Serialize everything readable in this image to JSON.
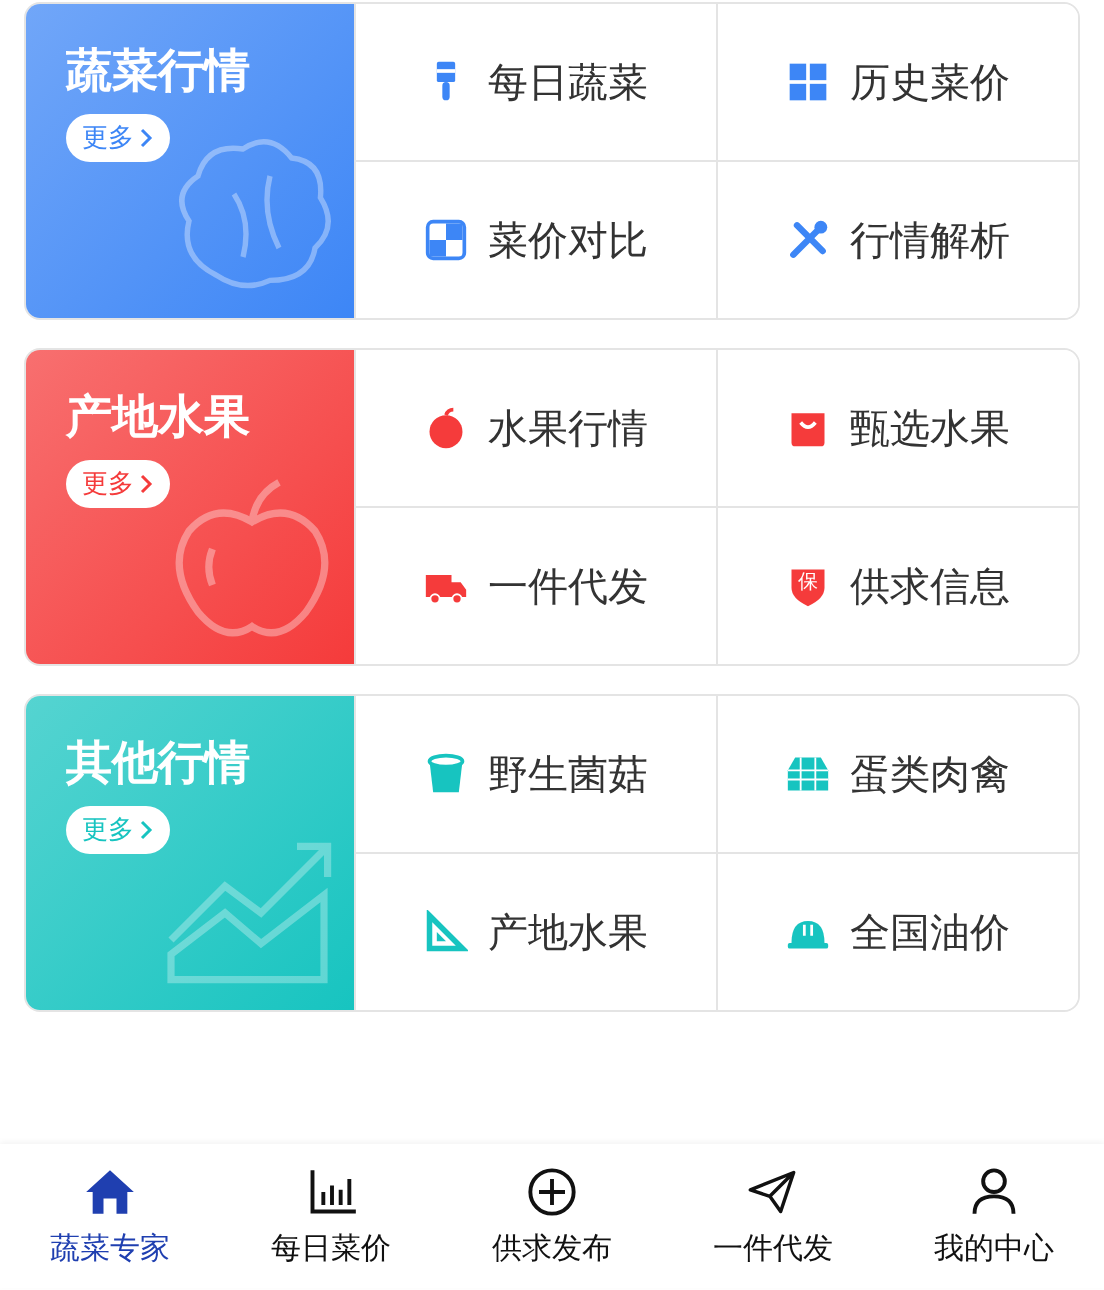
{
  "sections": [
    {
      "title": "蔬菜行情",
      "more": "更多",
      "color": "#3d86f6",
      "items": [
        {
          "label": "每日蔬菜"
        },
        {
          "label": "历史菜价"
        },
        {
          "label": "菜价对比"
        },
        {
          "label": "行情解析"
        }
      ]
    },
    {
      "title": "产地水果",
      "more": "更多",
      "color": "#f53b3b",
      "items": [
        {
          "label": "水果行情"
        },
        {
          "label": "甄选水果"
        },
        {
          "label": "一件代发"
        },
        {
          "badge": "保",
          "label": "供求信息"
        }
      ]
    },
    {
      "title": "其他行情",
      "more": "更多",
      "color": "#17c4c0",
      "items": [
        {
          "label": "野生菌菇"
        },
        {
          "label": "蛋类肉禽"
        },
        {
          "label": "产地水果"
        },
        {
          "label": "全国油价"
        }
      ]
    }
  ],
  "tabs": [
    {
      "label": "蔬菜专家",
      "selected": true
    },
    {
      "label": "每日菜价",
      "selected": false
    },
    {
      "label": "供求发布",
      "selected": false
    },
    {
      "label": "一件代发",
      "selected": false
    },
    {
      "label": "我的中心",
      "selected": false
    }
  ]
}
